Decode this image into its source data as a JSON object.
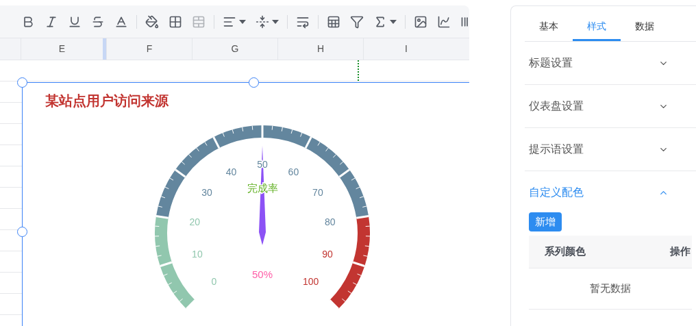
{
  "toolbar": [
    {
      "disabled": false,
      "dropdown": false
    },
    {
      "disabled": false,
      "dropdown": false
    },
    {
      "disabled": false,
      "dropdown": false
    },
    {
      "disabled": false,
      "dropdown": false
    },
    {
      "disabled": false,
      "dropdown": false
    },
    {
      "disabled": false,
      "dropdown": false
    },
    {
      "disabled": false,
      "dropdown": false
    },
    {
      "disabled": true,
      "dropdown": false
    },
    {
      "disabled": false,
      "dropdown": true
    },
    {
      "disabled": false,
      "dropdown": true
    },
    {
      "disabled": false,
      "dropdown": false
    },
    {
      "disabled": false,
      "dropdown": false
    },
    {
      "disabled": false,
      "dropdown": false
    },
    {
      "disabled": false,
      "dropdown": true
    },
    {
      "disabled": false,
      "dropdown": false
    },
    {
      "disabled": false,
      "dropdown": false
    },
    {
      "disabled": false,
      "dropdown": false
    }
  ],
  "columns": [
    "E",
    "F",
    "G",
    "H",
    "I"
  ],
  "chart": {
    "title": "某站点用户访问来源",
    "gauge": {
      "title": "完成率",
      "value_text": "50%",
      "level": 0.5,
      "scale_labels": [
        "0",
        "10",
        "20",
        "30",
        "40",
        "50",
        "60",
        "70",
        "80",
        "90",
        "100"
      ],
      "bands": [
        {
          "color": "#91c7ae"
        },
        {
          "color": "#63869e"
        },
        {
          "color": "#c23531"
        }
      ]
    }
  },
  "panel": {
    "tabs": [
      {
        "label": "基本",
        "selected": false
      },
      {
        "label": "样式",
        "selected": true
      },
      {
        "label": "数据",
        "selected": false
      }
    ],
    "sections": [
      {
        "label": "标题设置",
        "expanded": false
      },
      {
        "label": "仪表盘设置",
        "expanded": false
      },
      {
        "label": "提示语设置",
        "expanded": false
      },
      {
        "label": "自定义配色",
        "expanded": true,
        "content": {
          "add_button": "新增",
          "columns": [
            "系列颜色",
            "操作"
          ],
          "empty_text": "暂无数据"
        }
      }
    ]
  }
}
